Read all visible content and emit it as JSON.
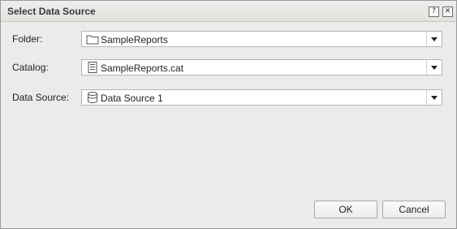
{
  "dialog": {
    "title": "Select Data Source",
    "help_label": "?",
    "close_label": "✕"
  },
  "fields": {
    "folder": {
      "label": "Folder:",
      "value": "SampleReports",
      "icon": "folder-icon"
    },
    "catalog": {
      "label": "Catalog:",
      "value": "SampleReports.cat",
      "icon": "catalog-file-icon"
    },
    "data_source": {
      "label": "Data Source:",
      "value": "Data Source 1",
      "icon": "database-icon"
    }
  },
  "buttons": {
    "ok_label": "OK",
    "cancel_label": "Cancel"
  }
}
